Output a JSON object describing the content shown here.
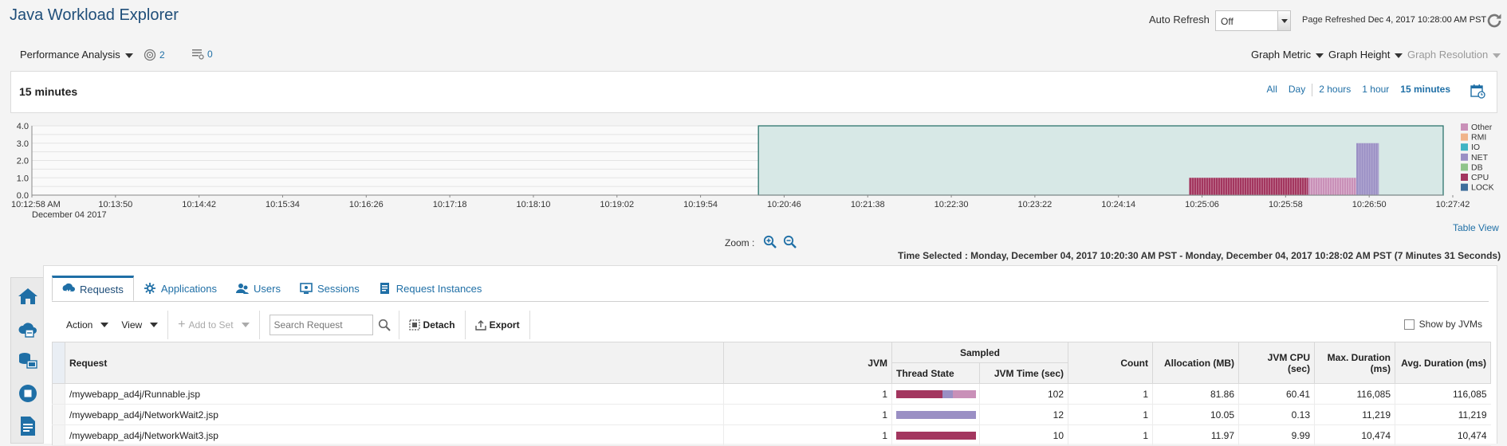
{
  "header": {
    "title": "Java Workload Explorer",
    "auto_refresh_label": "Auto Refresh",
    "auto_refresh_value": "Off",
    "page_refreshed_label": "Page Refreshed",
    "page_refreshed_value": "Dec 4, 2017 10:28:00 AM PST"
  },
  "toolbar2": {
    "perf_analysis": "Performance Analysis",
    "targets_count": "2",
    "list_count": "0",
    "graph_metric": "Graph Metric",
    "graph_height": "Graph Height",
    "graph_resolution": "Graph Resolution"
  },
  "time_panel": {
    "title": "15 minutes",
    "ranges": [
      "All",
      "Day",
      "2 hours",
      "1 hour",
      "15 minutes"
    ],
    "active_range": "15 minutes"
  },
  "chart_data": {
    "type": "bar",
    "stacked": true,
    "y_ticks": [
      "4.0",
      "3.0",
      "2.0",
      "1.0",
      "0.0"
    ],
    "ylim": [
      0,
      4
    ],
    "x_ticks": [
      "10:12:58 AM",
      "10:13:50",
      "10:14:42",
      "10:15:34",
      "10:16:26",
      "10:17:18",
      "10:18:10",
      "10:19:02",
      "10:19:54",
      "10:20:46",
      "10:21:38",
      "10:22:30",
      "10:23:22",
      "10:24:14",
      "10:25:06",
      "10:25:58",
      "10:26:50",
      "10:27:42"
    ],
    "x_sub_label": "December 04 2017",
    "legend": [
      {
        "name": "Other",
        "color": "#c990b8"
      },
      {
        "name": "RMI",
        "color": "#f0b48a"
      },
      {
        "name": "IO",
        "color": "#40b4c4"
      },
      {
        "name": "NET",
        "color": "#9a8fc4"
      },
      {
        "name": "DB",
        "color": "#8fc48a"
      },
      {
        "name": "CPU",
        "color": "#a3365f"
      },
      {
        "name": "LOCK",
        "color": "#3f6e9c"
      }
    ],
    "legend_position": "right",
    "selection": {
      "from": "10:20:30 AM",
      "to": "10:28:02 AM"
    },
    "series": [
      {
        "name": "CPU",
        "from": "10:24:58",
        "to": "10:26:12",
        "value": 1.0
      },
      {
        "name": "Other",
        "from": "10:26:12",
        "to": "10:26:42",
        "value": 1.0
      },
      {
        "name": "NET",
        "from": "10:26:42",
        "to": "10:26:56",
        "value": 3.0
      }
    ]
  },
  "chart_links": {
    "table_view": "Table View",
    "zoom_label": "Zoom :",
    "time_selected_label": "Time Selected :",
    "time_selected_value": "Monday, December 04, 2017 10:20:30 AM PST - Monday, December 04, 2017 10:28:02 AM PST (7 Minutes 31 Seconds)"
  },
  "tabs": [
    {
      "label": "Requests",
      "icon": "requests-icon"
    },
    {
      "label": "Applications",
      "icon": "applications-icon"
    },
    {
      "label": "Users",
      "icon": "users-icon"
    },
    {
      "label": "Sessions",
      "icon": "sessions-icon"
    },
    {
      "label": "Request Instances",
      "icon": "request-instances-icon"
    }
  ],
  "table_toolbar": {
    "action": "Action",
    "view": "View",
    "add_to_set": "Add to Set",
    "search_placeholder": "Search Request",
    "detach": "Detach",
    "export": "Export",
    "show_by_jvms": "Show by JVMs"
  },
  "table": {
    "headers": {
      "request": "Request",
      "jvm": "JVM",
      "sampled": "Sampled",
      "thread_state": "Thread State",
      "jvm_time": "JVM Time (sec)",
      "count": "Count",
      "allocation": "Allocation (MB)",
      "jvm_cpu": "JVM CPU (sec)",
      "max_duration": "Max. Duration (ms)",
      "avg_duration": "Avg. Duration (ms)"
    },
    "rows": [
      {
        "request": "/mywebapp_ad4j/Runnable.jsp",
        "jvm": "1",
        "jvm_time": "102",
        "count": "1",
        "allocation": "81.86",
        "jvm_cpu": "60.41",
        "max_duration": "116,085",
        "avg_duration": "116,085",
        "thread_state": [
          {
            "state": "CPU",
            "fraction": 0.58,
            "color": "#a3365f"
          },
          {
            "state": "NET",
            "fraction": 0.13,
            "color": "#9a8fc4"
          },
          {
            "state": "Other",
            "fraction": 0.29,
            "color": "#c990b8"
          }
        ]
      },
      {
        "request": "/mywebapp_ad4j/NetworkWait2.jsp",
        "jvm": "1",
        "jvm_time": "12",
        "count": "1",
        "allocation": "10.05",
        "jvm_cpu": "0.13",
        "max_duration": "11,219",
        "avg_duration": "11,219",
        "thread_state": [
          {
            "state": "NET",
            "fraction": 1.0,
            "color": "#9a8fc4"
          }
        ]
      },
      {
        "request": "/mywebapp_ad4j/NetworkWait3.jsp",
        "jvm": "1",
        "jvm_time": "10",
        "count": "1",
        "allocation": "11.97",
        "jvm_cpu": "9.99",
        "max_duration": "10,474",
        "avg_duration": "10,474",
        "thread_state": [
          {
            "state": "CPU",
            "fraction": 1.0,
            "color": "#a3365f"
          }
        ]
      }
    ]
  },
  "left_nav": [
    "home-icon",
    "cloud-target-icon",
    "databases-icon",
    "stop-icon",
    "report-icon"
  ]
}
